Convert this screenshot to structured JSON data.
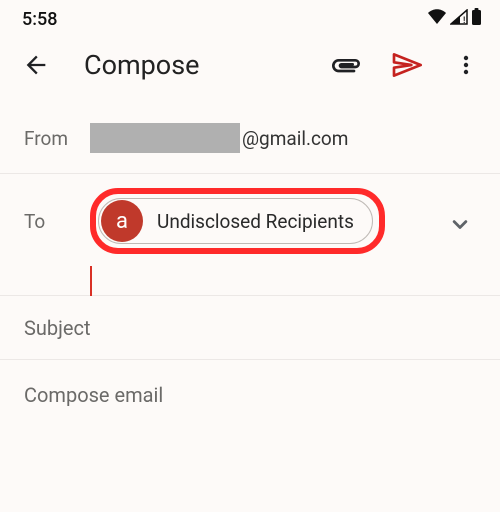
{
  "status": {
    "time": "5:58"
  },
  "appbar": {
    "title": "Compose"
  },
  "from": {
    "label": "From",
    "domain": "@gmail.com"
  },
  "to": {
    "label": "To",
    "chip": {
      "avatar_letter": "a",
      "text": "Undisclosed Recipients"
    }
  },
  "subject": {
    "placeholder": "Subject"
  },
  "body": {
    "placeholder": "Compose email"
  }
}
